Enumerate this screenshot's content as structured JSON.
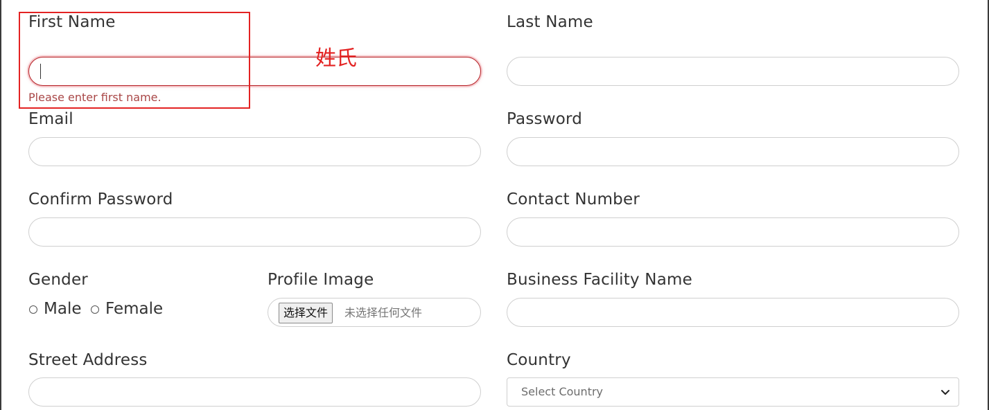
{
  "form": {
    "first_name": {
      "label": "First Name",
      "value": "",
      "error": "Please enter first name."
    },
    "last_name": {
      "label": "Last Name",
      "value": ""
    },
    "email": {
      "label": "Email",
      "value": ""
    },
    "password": {
      "label": "Password",
      "value": ""
    },
    "confirm_password": {
      "label": "Confirm Password",
      "value": ""
    },
    "contact_number": {
      "label": "Contact Number",
      "value": ""
    },
    "gender": {
      "label": "Gender",
      "options": [
        "Male",
        "Female"
      ],
      "selected": null
    },
    "profile_image": {
      "label": "Profile Image",
      "button_label": "选择文件",
      "status": "未选择任何文件"
    },
    "business_facility_name": {
      "label": "Business Facility Name",
      "value": ""
    },
    "street_address": {
      "label": "Street Address",
      "value": ""
    },
    "country": {
      "label": "Country",
      "selected": "Select Country"
    }
  },
  "annotation": {
    "text": "姓氏"
  },
  "colors": {
    "error": "#b52227",
    "annotation": "#e32222",
    "text": "#333333",
    "border": "#cfcfcf"
  },
  "icons": {
    "select_chevron": "chevron-down-icon"
  }
}
